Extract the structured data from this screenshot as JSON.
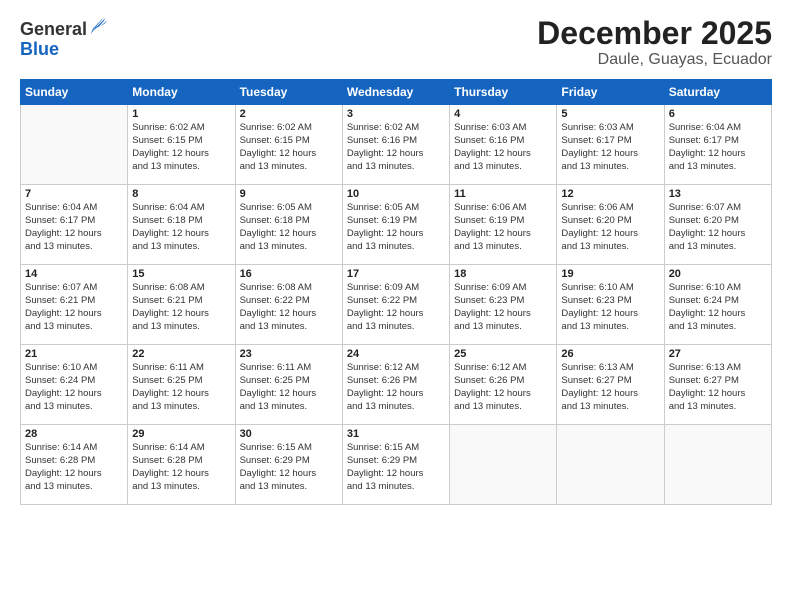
{
  "logo": {
    "general": "General",
    "blue": "Blue"
  },
  "title": "December 2025",
  "subtitle": "Daule, Guayas, Ecuador",
  "days": [
    "Sunday",
    "Monday",
    "Tuesday",
    "Wednesday",
    "Thursday",
    "Friday",
    "Saturday"
  ],
  "weeks": [
    [
      {
        "date": "",
        "info": ""
      },
      {
        "date": "1",
        "info": "Sunrise: 6:02 AM\nSunset: 6:15 PM\nDaylight: 12 hours\nand 13 minutes."
      },
      {
        "date": "2",
        "info": "Sunrise: 6:02 AM\nSunset: 6:15 PM\nDaylight: 12 hours\nand 13 minutes."
      },
      {
        "date": "3",
        "info": "Sunrise: 6:02 AM\nSunset: 6:16 PM\nDaylight: 12 hours\nand 13 minutes."
      },
      {
        "date": "4",
        "info": "Sunrise: 6:03 AM\nSunset: 6:16 PM\nDaylight: 12 hours\nand 13 minutes."
      },
      {
        "date": "5",
        "info": "Sunrise: 6:03 AM\nSunset: 6:17 PM\nDaylight: 12 hours\nand 13 minutes."
      },
      {
        "date": "6",
        "info": "Sunrise: 6:04 AM\nSunset: 6:17 PM\nDaylight: 12 hours\nand 13 minutes."
      }
    ],
    [
      {
        "date": "7",
        "info": "Sunrise: 6:04 AM\nSunset: 6:17 PM\nDaylight: 12 hours\nand 13 minutes."
      },
      {
        "date": "8",
        "info": "Sunrise: 6:04 AM\nSunset: 6:18 PM\nDaylight: 12 hours\nand 13 minutes."
      },
      {
        "date": "9",
        "info": "Sunrise: 6:05 AM\nSunset: 6:18 PM\nDaylight: 12 hours\nand 13 minutes."
      },
      {
        "date": "10",
        "info": "Sunrise: 6:05 AM\nSunset: 6:19 PM\nDaylight: 12 hours\nand 13 minutes."
      },
      {
        "date": "11",
        "info": "Sunrise: 6:06 AM\nSunset: 6:19 PM\nDaylight: 12 hours\nand 13 minutes."
      },
      {
        "date": "12",
        "info": "Sunrise: 6:06 AM\nSunset: 6:20 PM\nDaylight: 12 hours\nand 13 minutes."
      },
      {
        "date": "13",
        "info": "Sunrise: 6:07 AM\nSunset: 6:20 PM\nDaylight: 12 hours\nand 13 minutes."
      }
    ],
    [
      {
        "date": "14",
        "info": "Sunrise: 6:07 AM\nSunset: 6:21 PM\nDaylight: 12 hours\nand 13 minutes."
      },
      {
        "date": "15",
        "info": "Sunrise: 6:08 AM\nSunset: 6:21 PM\nDaylight: 12 hours\nand 13 minutes."
      },
      {
        "date": "16",
        "info": "Sunrise: 6:08 AM\nSunset: 6:22 PM\nDaylight: 12 hours\nand 13 minutes."
      },
      {
        "date": "17",
        "info": "Sunrise: 6:09 AM\nSunset: 6:22 PM\nDaylight: 12 hours\nand 13 minutes."
      },
      {
        "date": "18",
        "info": "Sunrise: 6:09 AM\nSunset: 6:23 PM\nDaylight: 12 hours\nand 13 minutes."
      },
      {
        "date": "19",
        "info": "Sunrise: 6:10 AM\nSunset: 6:23 PM\nDaylight: 12 hours\nand 13 minutes."
      },
      {
        "date": "20",
        "info": "Sunrise: 6:10 AM\nSunset: 6:24 PM\nDaylight: 12 hours\nand 13 minutes."
      }
    ],
    [
      {
        "date": "21",
        "info": "Sunrise: 6:10 AM\nSunset: 6:24 PM\nDaylight: 12 hours\nand 13 minutes."
      },
      {
        "date": "22",
        "info": "Sunrise: 6:11 AM\nSunset: 6:25 PM\nDaylight: 12 hours\nand 13 minutes."
      },
      {
        "date": "23",
        "info": "Sunrise: 6:11 AM\nSunset: 6:25 PM\nDaylight: 12 hours\nand 13 minutes."
      },
      {
        "date": "24",
        "info": "Sunrise: 6:12 AM\nSunset: 6:26 PM\nDaylight: 12 hours\nand 13 minutes."
      },
      {
        "date": "25",
        "info": "Sunrise: 6:12 AM\nSunset: 6:26 PM\nDaylight: 12 hours\nand 13 minutes."
      },
      {
        "date": "26",
        "info": "Sunrise: 6:13 AM\nSunset: 6:27 PM\nDaylight: 12 hours\nand 13 minutes."
      },
      {
        "date": "27",
        "info": "Sunrise: 6:13 AM\nSunset: 6:27 PM\nDaylight: 12 hours\nand 13 minutes."
      }
    ],
    [
      {
        "date": "28",
        "info": "Sunrise: 6:14 AM\nSunset: 6:28 PM\nDaylight: 12 hours\nand 13 minutes."
      },
      {
        "date": "29",
        "info": "Sunrise: 6:14 AM\nSunset: 6:28 PM\nDaylight: 12 hours\nand 13 minutes."
      },
      {
        "date": "30",
        "info": "Sunrise: 6:15 AM\nSunset: 6:29 PM\nDaylight: 12 hours\nand 13 minutes."
      },
      {
        "date": "31",
        "info": "Sunrise: 6:15 AM\nSunset: 6:29 PM\nDaylight: 12 hours\nand 13 minutes."
      },
      {
        "date": "",
        "info": ""
      },
      {
        "date": "",
        "info": ""
      },
      {
        "date": "",
        "info": ""
      }
    ]
  ]
}
